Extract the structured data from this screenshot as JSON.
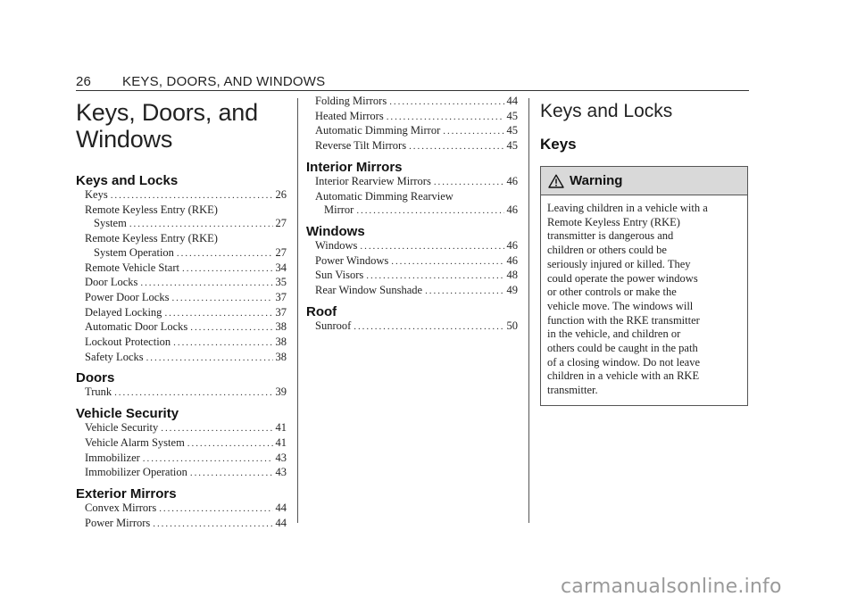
{
  "header": {
    "page_number": "26",
    "running_title": "KEYS, DOORS, AND WINDOWS"
  },
  "chapter_title_line1": "Keys, Doors, and",
  "chapter_title_line2": "Windows",
  "toc_col1": [
    {
      "section": "Keys and Locks",
      "entries": [
        {
          "label": "Keys",
          "page": "26"
        },
        {
          "label": "Remote Keyless Entry (RKE)",
          "label_cont": "System",
          "page": "27"
        },
        {
          "label": "Remote Keyless Entry (RKE)",
          "label_cont": "System Operation",
          "page": "27"
        },
        {
          "label": "Remote Vehicle Start",
          "page": "34"
        },
        {
          "label": "Door Locks",
          "page": "35"
        },
        {
          "label": "Power Door Locks",
          "page": "37"
        },
        {
          "label": "Delayed Locking",
          "page": "37"
        },
        {
          "label": "Automatic Door Locks",
          "page": "38"
        },
        {
          "label": "Lockout Protection",
          "page": "38"
        },
        {
          "label": "Safety Locks",
          "page": "38"
        }
      ]
    },
    {
      "section": "Doors",
      "entries": [
        {
          "label": "Trunk",
          "page": "39"
        }
      ]
    },
    {
      "section": "Vehicle Security",
      "entries": [
        {
          "label": "Vehicle Security",
          "page": "41"
        },
        {
          "label": "Vehicle Alarm System",
          "page": "41"
        },
        {
          "label": "Immobilizer",
          "page": "43"
        },
        {
          "label": "Immobilizer Operation",
          "page": "43"
        }
      ]
    },
    {
      "section": "Exterior Mirrors",
      "entries": [
        {
          "label": "Convex Mirrors",
          "page": "44"
        },
        {
          "label": "Power Mirrors",
          "page": "44"
        }
      ]
    }
  ],
  "toc_col2": [
    {
      "section": "",
      "entries": [
        {
          "label": "Folding Mirrors",
          "page": "44"
        },
        {
          "label": "Heated Mirrors",
          "page": "45"
        },
        {
          "label": "Automatic Dimming Mirror",
          "page": "45"
        },
        {
          "label": "Reverse Tilt Mirrors",
          "page": "45"
        }
      ]
    },
    {
      "section": "Interior Mirrors",
      "entries": [
        {
          "label": "Interior Rearview Mirrors",
          "page": "46"
        },
        {
          "label": "Automatic Dimming Rearview",
          "label_cont": "Mirror",
          "page": "46"
        }
      ]
    },
    {
      "section": "Windows",
      "entries": [
        {
          "label": "Windows",
          "page": "46"
        },
        {
          "label": "Power Windows",
          "page": "46"
        },
        {
          "label": "Sun Visors",
          "page": "48"
        },
        {
          "label": "Rear Window Sunshade",
          "page": "49"
        }
      ]
    },
    {
      "section": "Roof",
      "entries": [
        {
          "label": "Sunroof",
          "page": "50"
        }
      ]
    }
  ],
  "body": {
    "heading": "Keys and Locks",
    "subheading": "Keys",
    "warning": {
      "icon": "warning-triangle-icon",
      "title": "Warning",
      "lines": [
        "Leaving children in a vehicle with a",
        "Remote Keyless Entry (RKE)",
        "transmitter is dangerous and",
        "children or others could be",
        "seriously injured or killed. They",
        "could operate the power windows",
        "or other controls or make the",
        "vehicle move. The windows will",
        "function with the RKE transmitter",
        "in the vehicle, and children or",
        "others could be caught in the path",
        "of a closing window. Do not leave",
        "children in a vehicle with an RKE",
        "transmitter."
      ]
    }
  },
  "watermark": "carmanualsonline.info"
}
